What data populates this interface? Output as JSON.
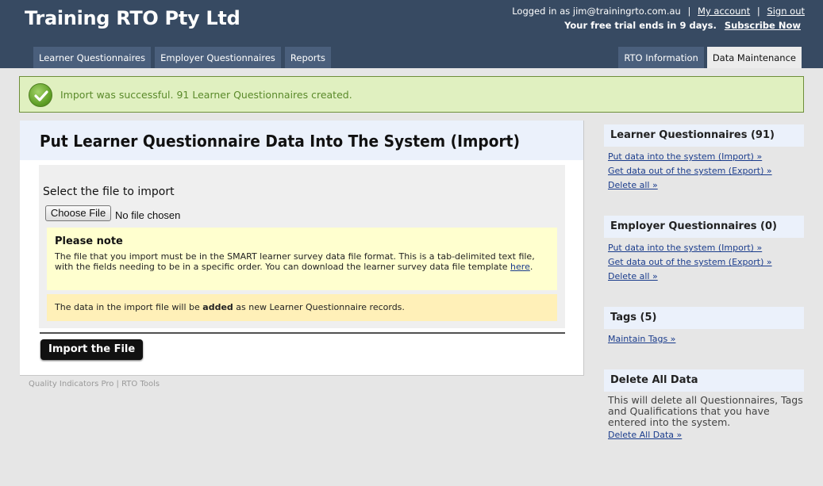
{
  "header": {
    "site_title": "Training RTO Pty Ltd",
    "logged_in_text": "Logged in as jim@trainingrto.com.au",
    "separator": "|",
    "my_account": "My account",
    "sign_out": "Sign out",
    "trial_text": "Your free trial ends in 9 days.",
    "subscribe": "Subscribe Now"
  },
  "nav": {
    "left_tabs": [
      {
        "label": "Learner Questionnaires",
        "active": false
      },
      {
        "label": "Employer Questionnaires",
        "active": false
      },
      {
        "label": "Reports",
        "active": false
      }
    ],
    "right_tabs": [
      {
        "label": "RTO Information",
        "active": false
      },
      {
        "label": "Data Maintenance",
        "active": true
      }
    ]
  },
  "flash": {
    "icon": "check-circle-icon",
    "message": "Import was successful. 91 Learner Questionnaires created."
  },
  "main": {
    "title": "Put Learner Questionnaire Data Into The System (Import)",
    "select_label": "Select the file to import",
    "file_button": "Choose File",
    "file_status": "No file chosen",
    "note": {
      "title": "Please note",
      "text": "The file that you import must be in the SMART learner survey data file format. This is a tab-delimited text file, with the fields needing to be in a specific order. You can download the learner survey data file template ",
      "link": "here",
      "after_link": "."
    },
    "added_notice": {
      "before": "The data in the import file will be ",
      "bold": "added",
      "after": " as new Learner Questionnaire records."
    },
    "import_button": "Import the File"
  },
  "footer": {
    "text": "Quality Indicators Pro | RTO Tools"
  },
  "sidebar": {
    "learner": {
      "title": "Learner Questionnaires (91)",
      "links": [
        "Put data into the system (Import) »",
        "Get data out of the system (Export) »",
        "Delete all »"
      ]
    },
    "employer": {
      "title": "Employer Questionnaires (0)",
      "links": [
        "Put data into the system (Import) »",
        "Get data out of the system (Export) »",
        "Delete all »"
      ]
    },
    "tags": {
      "title": "Tags (5)",
      "links": [
        "Maintain Tags »"
      ]
    },
    "delete_all": {
      "title": "Delete All Data",
      "description": "This will delete all Questionnaires, Tags and Qualifications that you have entered into the system.",
      "link": "Delete All Data »"
    }
  },
  "colors": {
    "header_bg": "#374a62",
    "tab_bg": "#4a5f7c",
    "flash_bg": "#e0f0c0",
    "flash_text": "#5a8a2a",
    "note_bg": "#ffffcf",
    "added_bg": "#fff0b8",
    "link": "#1a3c8c"
  }
}
